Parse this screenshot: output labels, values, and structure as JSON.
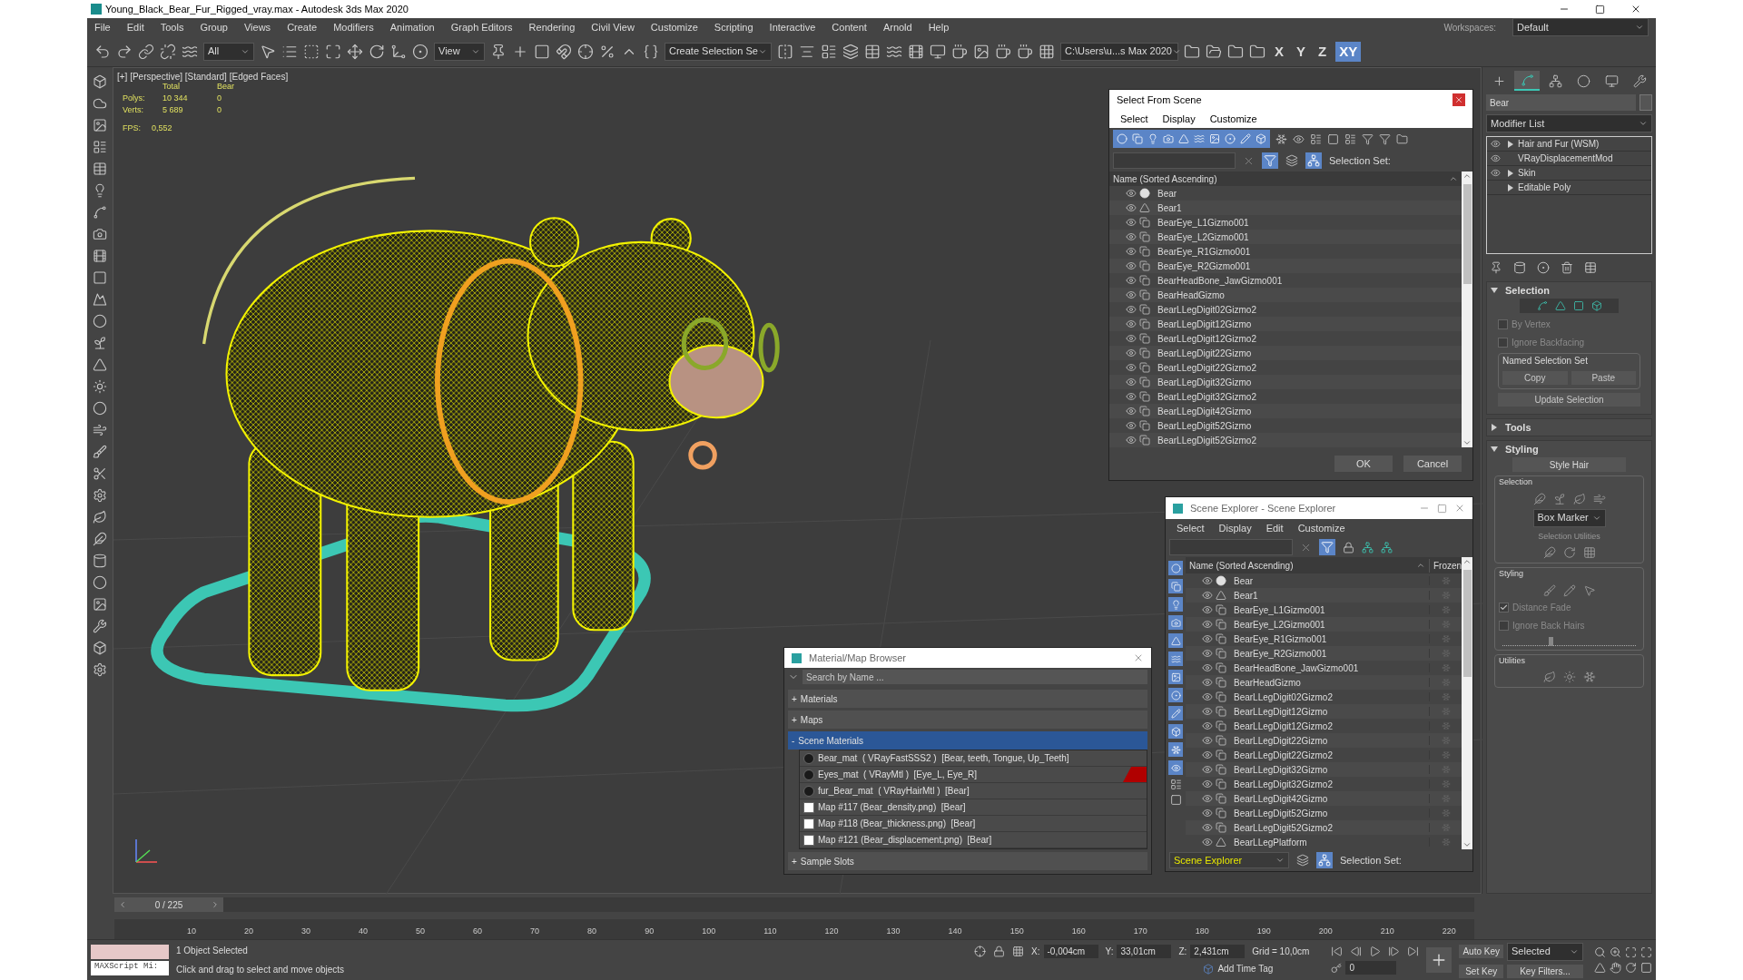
{
  "window": {
    "title": "Young_Black_Bear_Fur_Rigged_vray.max - Autodesk 3ds Max 2020"
  },
  "menu": [
    "File",
    "Edit",
    "Tools",
    "Group",
    "Views",
    "Create",
    "Modifiers",
    "Animation",
    "Graph Editors",
    "Rendering",
    "Civil View",
    "Customize",
    "Scripting",
    "Interactive",
    "Content",
    "Arnold",
    "Help"
  ],
  "workspace": {
    "label": "Workspaces:",
    "value": "Default"
  },
  "toolbar": {
    "filter": "All",
    "coord_system": "View",
    "selection_set": "Create Selection Se",
    "project_path": "C:\\Users\\u...s Max 2020",
    "axes": [
      {
        "label": "X",
        "selected": false
      },
      {
        "label": "Y",
        "selected": false
      },
      {
        "label": "Z",
        "selected": false
      },
      {
        "label": "XY",
        "selected": true
      }
    ]
  },
  "viewport": {
    "label": "[+] [Perspective] [Standard] [Edged Faces]",
    "stats": {
      "columns": [
        "Total",
        "Bear"
      ],
      "rows": [
        {
          "label": "Polys:",
          "values": [
            "10 344",
            "0"
          ]
        },
        {
          "label": "Verts:",
          "values": [
            "5 689",
            "0"
          ]
        }
      ],
      "fps_label": "FPS:",
      "fps": "0,552"
    }
  },
  "select_from_scene": {
    "title": "Select From Scene",
    "menu": [
      "Select",
      "Display",
      "Customize"
    ],
    "selection_set": "Selection Set:",
    "column": "Name (Sorted Ascending)",
    "rows": [
      {
        "name": "Bear",
        "kind": "geometry"
      },
      {
        "name": "Bear1",
        "kind": "bone"
      },
      {
        "name": "BearEye_L1Gizmo001",
        "kind": "gizmo"
      },
      {
        "name": "BearEye_L2Gizmo001",
        "kind": "gizmo"
      },
      {
        "name": "BearEye_R1Gizmo001",
        "kind": "gizmo"
      },
      {
        "name": "BearEye_R2Gizmo001",
        "kind": "gizmo"
      },
      {
        "name": "BearHeadBone_JawGizmo001",
        "kind": "gizmo"
      },
      {
        "name": "BearHeadGizmo",
        "kind": "gizmo"
      },
      {
        "name": "BearLLegDigit02Gizmo2",
        "kind": "gizmo"
      },
      {
        "name": "BearLLegDigit12Gizmo",
        "kind": "gizmo"
      },
      {
        "name": "BearLLegDigit12Gizmo2",
        "kind": "gizmo"
      },
      {
        "name": "BearLLegDigit22Gizmo",
        "kind": "gizmo"
      },
      {
        "name": "BearLLegDigit22Gizmo2",
        "kind": "gizmo"
      },
      {
        "name": "BearLLegDigit32Gizmo",
        "kind": "gizmo"
      },
      {
        "name": "BearLLegDigit32Gizmo2",
        "kind": "gizmo"
      },
      {
        "name": "BearLLegDigit42Gizmo",
        "kind": "gizmo"
      },
      {
        "name": "BearLLegDigit52Gizmo",
        "kind": "gizmo"
      },
      {
        "name": "BearLLegDigit52Gizmo2",
        "kind": "gizmo"
      }
    ],
    "ok": "OK",
    "cancel": "Cancel"
  },
  "scene_explorer": {
    "title": "Scene Explorer - Scene Explorer",
    "menu": [
      "Select",
      "Display",
      "Edit",
      "Customize"
    ],
    "column": "Name (Sorted Ascending)",
    "frozen_column": "Frozen",
    "rows": [
      {
        "name": "Bear",
        "kind": "geometry"
      },
      {
        "name": "Bear1",
        "kind": "bone"
      },
      {
        "name": "BearEye_L1Gizmo001",
        "kind": "gizmo"
      },
      {
        "name": "BearEye_L2Gizmo001",
        "kind": "gizmo"
      },
      {
        "name": "BearEye_R1Gizmo001",
        "kind": "gizmo"
      },
      {
        "name": "BearEye_R2Gizmo001",
        "kind": "gizmo"
      },
      {
        "name": "BearHeadBone_JawGizmo001",
        "kind": "gizmo"
      },
      {
        "name": "BearHeadGizmo",
        "kind": "gizmo"
      },
      {
        "name": "BearLLegDigit02Gizmo2",
        "kind": "gizmo"
      },
      {
        "name": "BearLLegDigit12Gizmo",
        "kind": "gizmo"
      },
      {
        "name": "BearLLegDigit12Gizmo2",
        "kind": "gizmo"
      },
      {
        "name": "BearLLegDigit22Gizmo",
        "kind": "gizmo"
      },
      {
        "name": "BearLLegDigit22Gizmo2",
        "kind": "gizmo"
      },
      {
        "name": "BearLLegDigit32Gizmo",
        "kind": "gizmo"
      },
      {
        "name": "BearLLegDigit32Gizmo2",
        "kind": "gizmo"
      },
      {
        "name": "BearLLegDigit42Gizmo",
        "kind": "gizmo"
      },
      {
        "name": "BearLLegDigit52Gizmo",
        "kind": "gizmo"
      },
      {
        "name": "BearLLegDigit52Gizmo2",
        "kind": "gizmo"
      },
      {
        "name": "BearLLegPlatform",
        "kind": "bone"
      }
    ],
    "footer_dropdown": "Scene Explorer",
    "selection_set": "Selection Set:"
  },
  "material_browser": {
    "title": "Material/Map Browser",
    "search_placeholder": "Search by Name ...",
    "groups": [
      {
        "sign": "+",
        "label": "Materials",
        "expanded": false
      },
      {
        "sign": "+",
        "label": "Maps",
        "expanded": false
      },
      {
        "sign": "-",
        "label": "Scene Materials",
        "expanded": true,
        "items": [
          {
            "label": "Bear_mat  ( VRayFastSSS2 )  [Bear, teeth, Tongue, Up_Teeth]",
            "kind": "material",
            "flagged": false
          },
          {
            "label": "Eyes_mat  ( VRayMtl )  [Eye_L, Eye_R]",
            "kind": "material",
            "flagged": true
          },
          {
            "label": "fur_Bear_mat  ( VRayHairMtl )  [Bear]",
            "kind": "material",
            "flagged": false
          },
          {
            "label": "Map #117 (Bear_density.png)  [Bear]",
            "kind": "map",
            "flagged": false
          },
          {
            "label": "Map #118 (Bear_thickness.png)  [Bear]",
            "kind": "map",
            "flagged": false
          },
          {
            "label": "Map #121 (Bear_displacement.png)  [Bear]",
            "kind": "map",
            "flagged": false
          }
        ]
      },
      {
        "sign": "+",
        "label": "Sample Slots",
        "expanded": false
      }
    ]
  },
  "command_panel": {
    "tabs": [
      {
        "selected": false
      },
      {
        "selected": true
      },
      {
        "selected": false
      },
      {
        "selected": false
      },
      {
        "selected": false
      },
      {
        "selected": false
      }
    ],
    "object_name": "Bear",
    "modifier_list": "Modifier List",
    "stack": [
      {
        "label": "Hair and Fur (WSM)",
        "visible": true,
        "expandable": true
      },
      {
        "label": "VRayDisplacementMod",
        "visible": true,
        "expandable": false
      },
      {
        "label": "Skin",
        "visible": true,
        "expandable": true
      },
      {
        "label": "Editable Poly",
        "visible": false,
        "expandable": true
      }
    ],
    "selection_rollout": {
      "title": "Selection",
      "expanded": true,
      "checkboxes": [
        {
          "label": "By Vertex",
          "checked": false
        },
        {
          "label": "Ignore Backfacing",
          "checked": false
        }
      ],
      "named_set": "Named Selection Set",
      "buttons": [
        "Copy",
        "Paste"
      ],
      "update_button": "Update Selection"
    },
    "tools_rollout": {
      "title": "Tools",
      "expanded": false
    },
    "styling_rollout": {
      "title": "Styling",
      "expanded": true,
      "style_button": "Style Hair",
      "selection_group": "Selection",
      "marker": "Box Marker",
      "utilities_label": "Selection Utilities",
      "styling_group": "Styling",
      "checkboxes": [
        {
          "label": "Distance Fade",
          "checked": true
        },
        {
          "label": "Ignore Back Hairs",
          "checked": false
        }
      ],
      "slider": {
        "level": 0.35
      },
      "utilities_group": "Utilities"
    }
  },
  "timeline": {
    "frame_counter": "0 / 225",
    "level": 0,
    "ticks": [
      "10",
      "20",
      "30",
      "40",
      "50",
      "60",
      "70",
      "80",
      "90",
      "100",
      "110",
      "120",
      "130",
      "140",
      "150",
      "160",
      "170",
      "180",
      "190",
      "200",
      "210",
      "220"
    ]
  },
  "status": {
    "maxscript": "MAXScript Mi:",
    "selected_count": "1 Object Selected",
    "prompt": "Click and drag to select and move objects",
    "coords": [
      {
        "axis": "X:",
        "value": "-0,004cm"
      },
      {
        "axis": "Y:",
        "value": "33,01cm"
      },
      {
        "axis": "Z:",
        "value": "2,431cm"
      }
    ],
    "grid": "Grid = 10,0cm",
    "add_time_tag": "Add Time Tag",
    "frame": "0",
    "auto_key": "Auto Key",
    "key_mode": "Selected",
    "set_key": "Set Key",
    "key_filters": "Key Filters..."
  }
}
